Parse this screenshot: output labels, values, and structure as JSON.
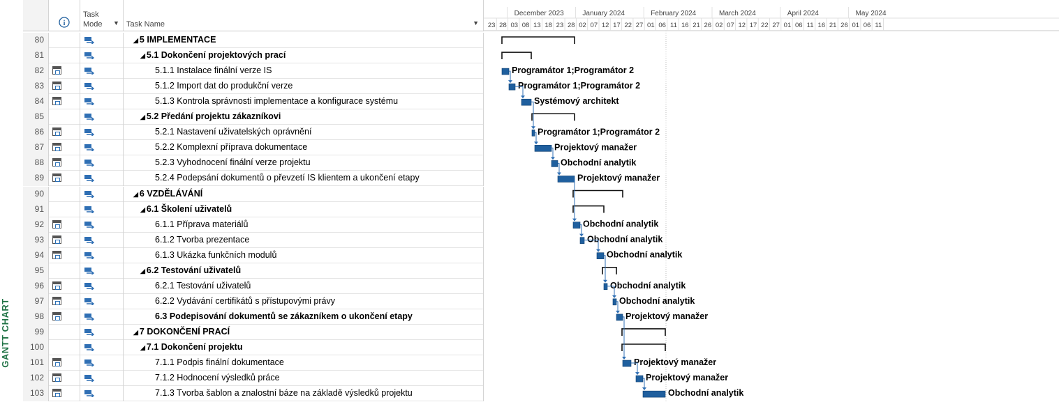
{
  "side_label": "GANTT CHART",
  "header": {
    "info_icon": "i",
    "task_mode_line1": "Task",
    "task_mode_line2": "Mode",
    "task_name": "Task Name",
    "months": [
      "December 2023",
      "January 2024",
      "February 2024",
      "March 2024",
      "April 2024",
      "May 2024"
    ],
    "days": [
      "23",
      "28",
      "03",
      "08",
      "13",
      "18",
      "23",
      "28",
      "02",
      "07",
      "12",
      "17",
      "22",
      "27",
      "01",
      "06",
      "11",
      "16",
      "21",
      "26",
      "02",
      "07",
      "12",
      "17",
      "22",
      "27",
      "01",
      "06",
      "11",
      "16",
      "21",
      "26",
      "01",
      "06",
      "11"
    ]
  },
  "rows": [
    {
      "id": "80",
      "cal": false,
      "summary": true,
      "indent": 0,
      "name": "5 IMPLEMENTACE",
      "resource": ""
    },
    {
      "id": "81",
      "cal": false,
      "summary": true,
      "indent": 1,
      "name": "5.1 Dokončení projektových prací",
      "resource": ""
    },
    {
      "id": "82",
      "cal": true,
      "summary": false,
      "indent": 2,
      "name": "5.1.1 Instalace finální verze IS",
      "resource": "Programátor 1;Programátor 2"
    },
    {
      "id": "83",
      "cal": true,
      "summary": false,
      "indent": 2,
      "name": "5.1.2 Import dat do produkční verze",
      "resource": "Programátor 1;Programátor 2"
    },
    {
      "id": "84",
      "cal": true,
      "summary": false,
      "indent": 2,
      "name": "5.1.3 Kontrola správnosti implementace a konfigurace systému",
      "resource": "Systémový architekt"
    },
    {
      "id": "85",
      "cal": false,
      "summary": true,
      "indent": 1,
      "name": "5.2 Předání projektu zákazníkovi",
      "resource": ""
    },
    {
      "id": "86",
      "cal": true,
      "summary": false,
      "indent": 2,
      "name": "5.2.1 Nastavení uživatelských oprávnění",
      "resource": "Programátor 1;Programátor 2"
    },
    {
      "id": "87",
      "cal": true,
      "summary": false,
      "indent": 2,
      "name": "5.2.2 Komplexní příprava dokumentace",
      "resource": "Projektový manažer"
    },
    {
      "id": "88",
      "cal": true,
      "summary": false,
      "indent": 2,
      "name": "5.2.3 Vyhodnocení finální verze projektu",
      "resource": "Obchodní analytik"
    },
    {
      "id": "89",
      "cal": true,
      "summary": false,
      "indent": 2,
      "name": "5.2.4 Podepsání dokumentů o převzetí IS klientem a ukončení etapy",
      "resource": "Projektový manažer"
    },
    {
      "id": "90",
      "cal": false,
      "summary": true,
      "indent": 0,
      "name": "6 VZDĚLÁVÁNÍ",
      "resource": ""
    },
    {
      "id": "91",
      "cal": false,
      "summary": true,
      "indent": 1,
      "name": "6.1 Školení uživatelů",
      "resource": ""
    },
    {
      "id": "92",
      "cal": true,
      "summary": false,
      "indent": 2,
      "name": "6.1.1 Příprava materiálů",
      "resource": "Obchodní analytik"
    },
    {
      "id": "93",
      "cal": true,
      "summary": false,
      "indent": 2,
      "name": "6.1.2 Tvorba prezentace",
      "resource": "Obchodní analytik"
    },
    {
      "id": "94",
      "cal": true,
      "summary": false,
      "indent": 2,
      "name": "6.1.3 Ukázka funkčních modulů",
      "resource": "Obchodní analytik"
    },
    {
      "id": "95",
      "cal": false,
      "summary": true,
      "indent": 1,
      "name": "6.2 Testování uživatelů",
      "resource": ""
    },
    {
      "id": "96",
      "cal": true,
      "summary": false,
      "indent": 2,
      "name": "6.2.1 Testování uživatelů",
      "resource": "Obchodní analytik"
    },
    {
      "id": "97",
      "cal": true,
      "summary": false,
      "indent": 2,
      "name": "6.2.2 Vydávání certifikátů s přístupovými právy",
      "resource": "Obchodní analytik"
    },
    {
      "id": "98",
      "cal": true,
      "summary": true,
      "indent": 1,
      "name": "6.3 Podepisování dokumentů se zákazníkem o ukončení etapy",
      "resource": "Projektový manažer"
    },
    {
      "id": "99",
      "cal": false,
      "summary": true,
      "indent": 0,
      "name": "7 DOKONČENÍ PRACÍ",
      "resource": ""
    },
    {
      "id": "100",
      "cal": false,
      "summary": true,
      "indent": 1,
      "name": "7.1 Dokončení projektu",
      "resource": ""
    },
    {
      "id": "101",
      "cal": true,
      "summary": false,
      "indent": 2,
      "name": "7.1.1 Podpis finální dokumentace",
      "resource": "Projektový manažer"
    },
    {
      "id": "102",
      "cal": true,
      "summary": false,
      "indent": 2,
      "name": "7.1.2 Hodnocení výsledků práce",
      "resource": "Projektový manažer"
    },
    {
      "id": "103",
      "cal": true,
      "summary": false,
      "indent": 2,
      "name": "7.1.3 Tvorba šablon a znalostní báze na základě výsledků projektu",
      "resource": "Obchodní analytik"
    }
  ],
  "colors": {
    "bar": "#1f5f9e",
    "accent": "#217346"
  }
}
